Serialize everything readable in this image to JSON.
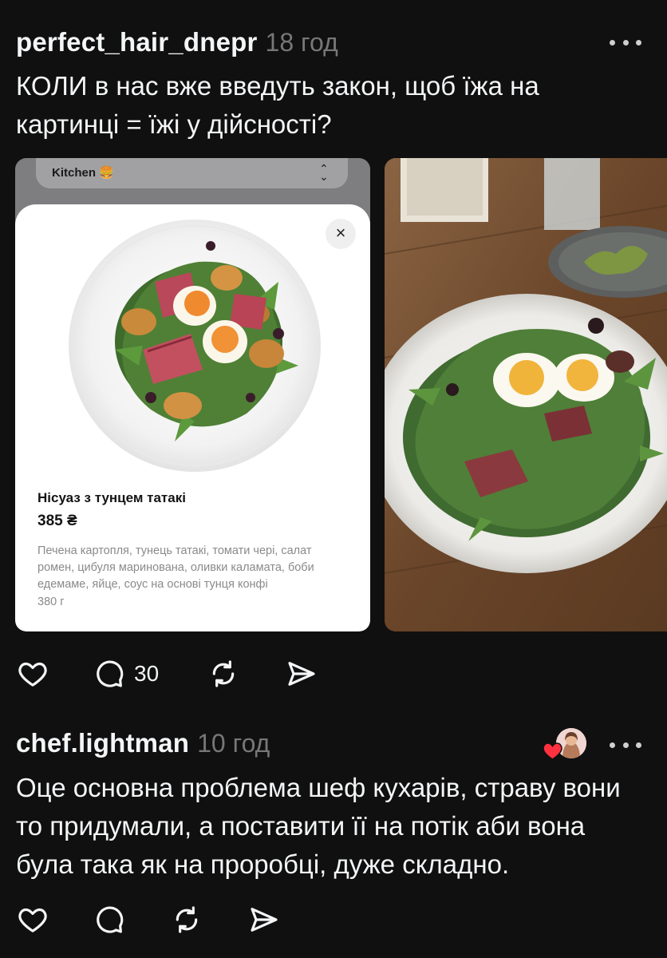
{
  "post": {
    "username": "perfect_hair_dnepr",
    "time": "18 год",
    "text": "КОЛИ  в нас вже введуть закон, щоб їжа на картинці = їжі у дійсності?",
    "menu_card": {
      "topbar_label": "Kitchen 🍔",
      "close_symbol": "×",
      "dish_name": "Нісуаз з тунцем татакі",
      "price": "385 ₴",
      "description": "Печена картопля, тунець татакі, томати черi, салат ромен, цибуля маринована, оливки каламата, боби едемаме, яйце, соус на основі тунця конфі",
      "weight": "380 г"
    },
    "actions": {
      "like_icon": "heart-icon",
      "comment_icon": "comment-icon",
      "comment_count": "30",
      "repost_icon": "repost-icon",
      "share_icon": "share-icon"
    }
  },
  "reply": {
    "username": "chef.lightman",
    "time": "10 год",
    "text": "Оце основна проблема шеф кухарів, страву вони то придумали, а поставити її на потік аби вона була така як на проробці, дуже складно.",
    "liked_by_author": true
  },
  "colors": {
    "background": "#101010",
    "text": "#f3f5f7",
    "muted": "#777777",
    "heart_red": "#ff3040"
  }
}
